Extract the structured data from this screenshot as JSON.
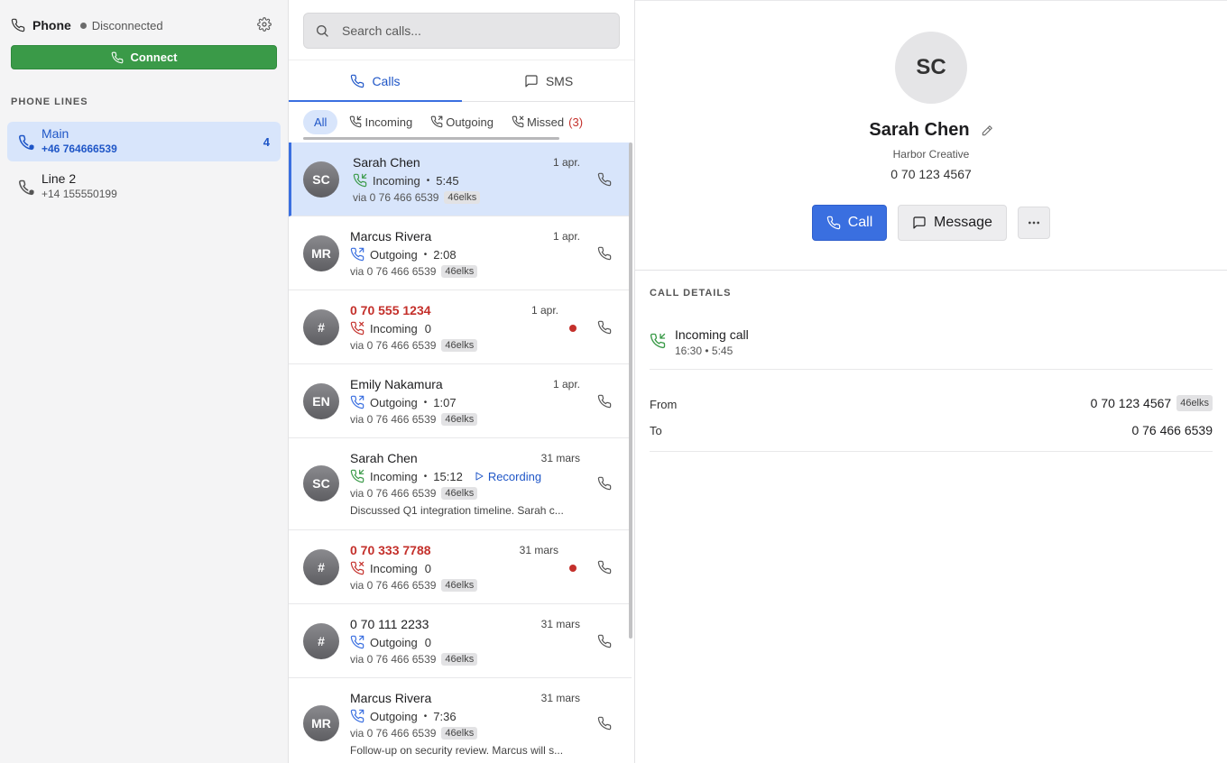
{
  "sidebar": {
    "title": "Phone",
    "status": "Disconnected",
    "connect_label": "Connect",
    "section_label": "PHONE LINES",
    "lines": [
      {
        "name": "Main",
        "number": "+46 764666539",
        "count": "4",
        "active": true
      },
      {
        "name": "Line 2",
        "number": "+14 155550199",
        "count": "",
        "active": false
      }
    ]
  },
  "search": {
    "placeholder": "Search calls..."
  },
  "tabs": [
    {
      "label": "Calls",
      "active": true
    },
    {
      "label": "SMS",
      "active": false
    }
  ],
  "filters": {
    "all": "All",
    "incoming": "Incoming",
    "outgoing": "Outgoing",
    "missed": "Missed",
    "missed_count": "(3)"
  },
  "calls": [
    {
      "initials": "SC",
      "name": "Sarah Chen",
      "date": "1 apr.",
      "direction": "Incoming",
      "duration": "5:45",
      "via": "via 0 76 466 6539",
      "provider": "46elks",
      "missed": false
    },
    {
      "initials": "MR",
      "name": "Marcus Rivera",
      "date": "1 apr.",
      "direction": "Outgoing",
      "duration": "2:08",
      "via": "via 0 76 466 6539",
      "provider": "46elks",
      "missed": false
    },
    {
      "initials": "#",
      "name": "0 70 555 1234",
      "date": "1 apr.",
      "direction": "Incoming",
      "duration": "0",
      "via": "via 0 76 466 6539",
      "provider": "46elks",
      "missed": true
    },
    {
      "initials": "EN",
      "name": "Emily Nakamura",
      "date": "1 apr.",
      "direction": "Outgoing",
      "duration": "1:07",
      "via": "via 0 76 466 6539",
      "provider": "46elks",
      "missed": false
    },
    {
      "initials": "SC",
      "name": "Sarah Chen",
      "date": "31 mars",
      "direction": "Incoming",
      "duration": "15:12",
      "recording": "Recording",
      "via": "via 0 76 466 6539",
      "provider": "46elks",
      "note": "Discussed Q1 integration timeline. Sarah c...",
      "missed": false
    },
    {
      "initials": "#",
      "name": "0 70 333 7788",
      "date": "31 mars",
      "direction": "Incoming",
      "duration": "0",
      "via": "via 0 76 466 6539",
      "provider": "46elks",
      "missed": true
    },
    {
      "initials": "#",
      "name": "0 70 111 2233",
      "date": "31 mars",
      "direction": "Outgoing",
      "duration": "0",
      "via": "via 0 76 466 6539",
      "provider": "46elks",
      "missed": false
    },
    {
      "initials": "MR",
      "name": "Marcus Rivera",
      "date": "31 mars",
      "direction": "Outgoing",
      "duration": "7:36",
      "via": "via 0 76 466 6539",
      "provider": "46elks",
      "note": "Follow-up on security review. Marcus will s...",
      "missed": false
    }
  ],
  "detail": {
    "initials": "SC",
    "name": "Sarah Chen",
    "company": "Harbor Creative",
    "phone": "0 70 123 4567",
    "call_label": "Call",
    "message_label": "Message",
    "section_label": "CALL DETAILS",
    "call_type": "Incoming call",
    "call_sub": "16:30 • 5:45",
    "from_label": "From",
    "from_value": "0 70 123 4567",
    "from_provider": "46elks",
    "to_label": "To",
    "to_value": "0 76 466 6539"
  },
  "colors": {
    "accent": "#3a6fe0",
    "connect": "#3a9a48",
    "missed": "#c4302b",
    "selected_bg": "#d8e5fb"
  }
}
